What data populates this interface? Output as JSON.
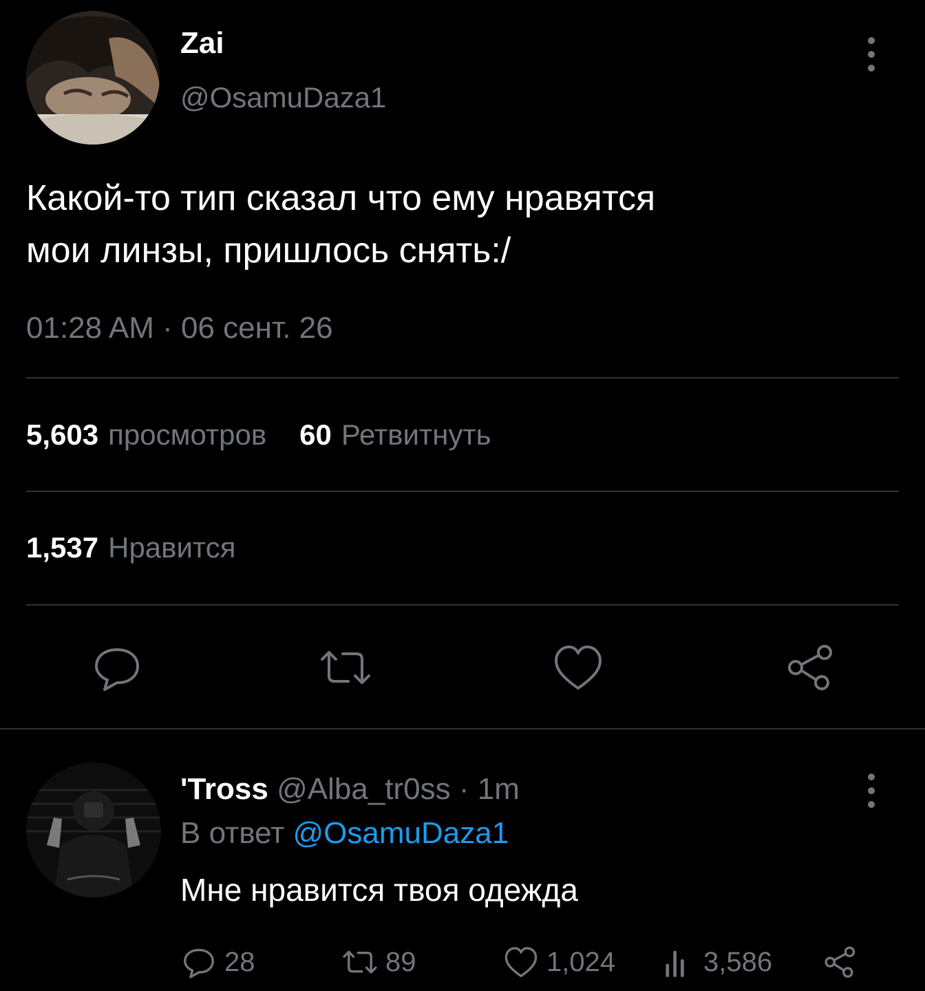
{
  "tweet": {
    "author": {
      "display_name": "Zai",
      "handle": "@OsamuDaza1"
    },
    "text": "Какой-то тип сказал что ему нравятся\nмои линзы, пришлось снять:/",
    "timestamp": "01:28 AM · 06 сент. 26",
    "stats": {
      "views_count": "5,603",
      "views_label": "просмотров",
      "retweets_count": "60",
      "retweets_label": "Ретвитнуть",
      "likes_count": "1,537",
      "likes_label": "Нравится"
    },
    "actions": [
      "reply-icon",
      "retweet-icon",
      "like-icon",
      "share-icon"
    ]
  },
  "reply": {
    "author": {
      "display_name": "'Tross",
      "handle": "@Alba_tr0ss",
      "time": " · 1m"
    },
    "reply_to_prefix": "В ответ ",
    "reply_to_mention": "@OsamuDaza1",
    "text": "Мне нравится твоя одежда",
    "counts": {
      "replies": "28",
      "retweets": "89",
      "likes": "1,024",
      "views": "3,586"
    }
  },
  "colors": {
    "background": "#000000",
    "primary_text": "#ffffff",
    "secondary_text": "#71767b",
    "divider": "#2f3336",
    "accent": "#1d9bf0"
  }
}
